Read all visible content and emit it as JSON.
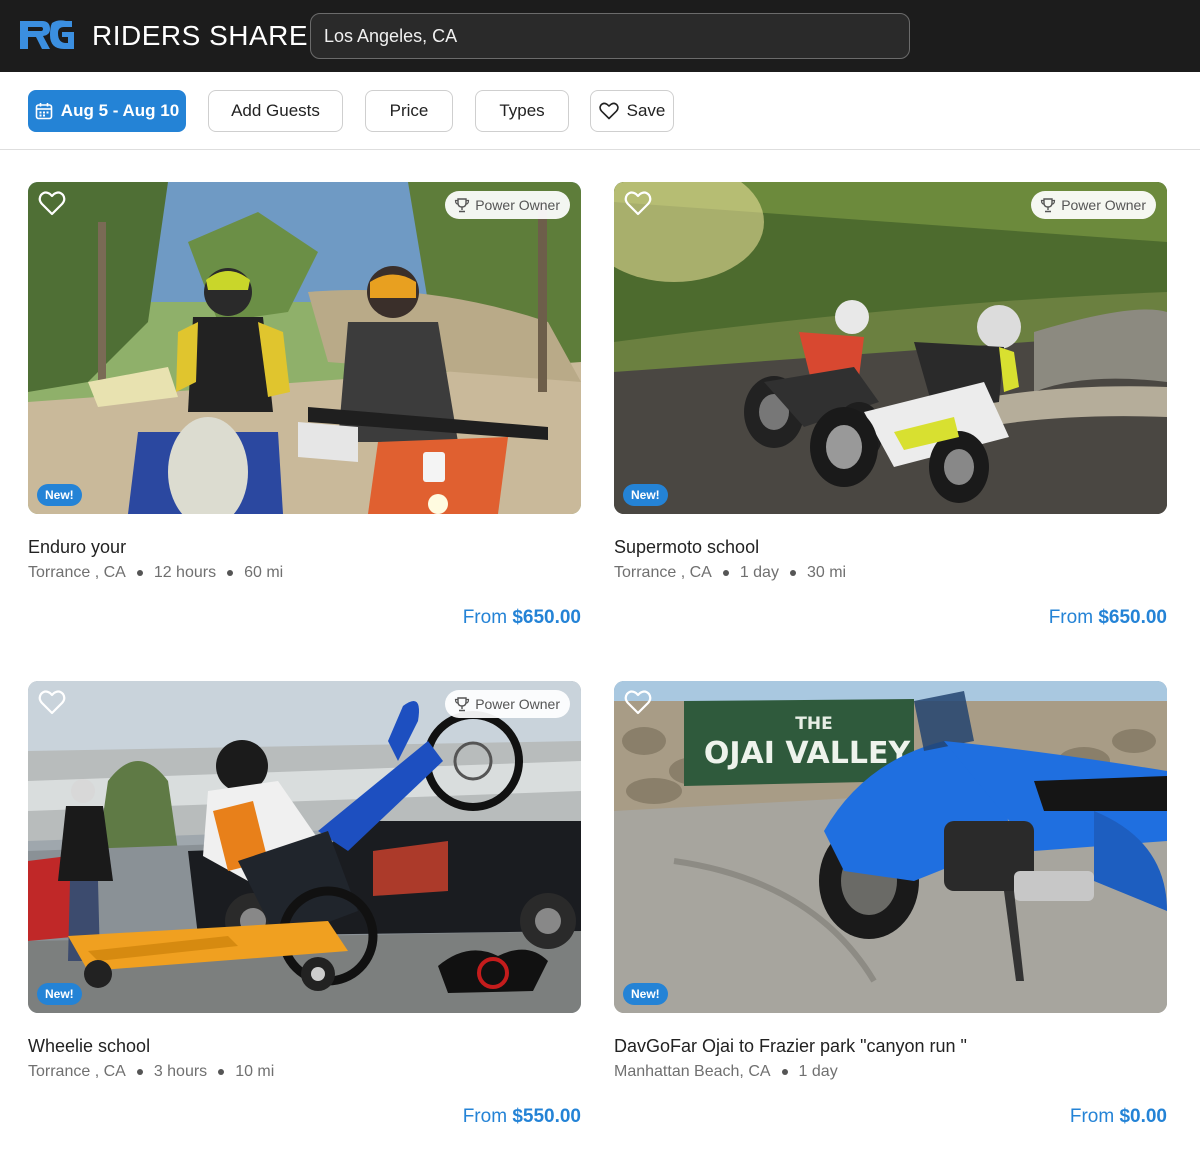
{
  "header": {
    "brand": "RIDERS SHARE",
    "search_value": "Los Angeles, CA"
  },
  "filters": {
    "dates": "Aug 5 - Aug 10",
    "guests": "Add Guests",
    "price": "Price",
    "types": "Types",
    "save": "Save"
  },
  "colors": {
    "accent": "#2483d6",
    "header_bg": "#1c1c1c"
  },
  "listings": [
    {
      "title": "Enduro your",
      "location": "Torrance , CA",
      "duration": "12 hours",
      "distance": "60 mi",
      "price_prefix": "From",
      "price": "$650.00",
      "new_label": "New!",
      "owner_badge": "Power Owner"
    },
    {
      "title": "Supermoto school",
      "location": "Torrance , CA",
      "duration": "1 day",
      "distance": "30 mi",
      "price_prefix": "From",
      "price": "$650.00",
      "new_label": "New!",
      "owner_badge": "Power Owner"
    },
    {
      "title": "Wheelie school",
      "location": "Torrance , CA",
      "duration": "3 hours",
      "distance": "10 mi",
      "price_prefix": "From",
      "price": "$550.00",
      "new_label": "New!",
      "owner_badge": "Power Owner"
    },
    {
      "title": "DavGoFar Ojai to Frazier park \"canyon run \"",
      "location": "Manhattan Beach, CA",
      "duration": "1 day",
      "price_prefix": "From",
      "price": "$0.00",
      "new_label": "New!",
      "photo_sign_line1": "THE",
      "photo_sign_line2": "OJAI VALLEY"
    }
  ]
}
